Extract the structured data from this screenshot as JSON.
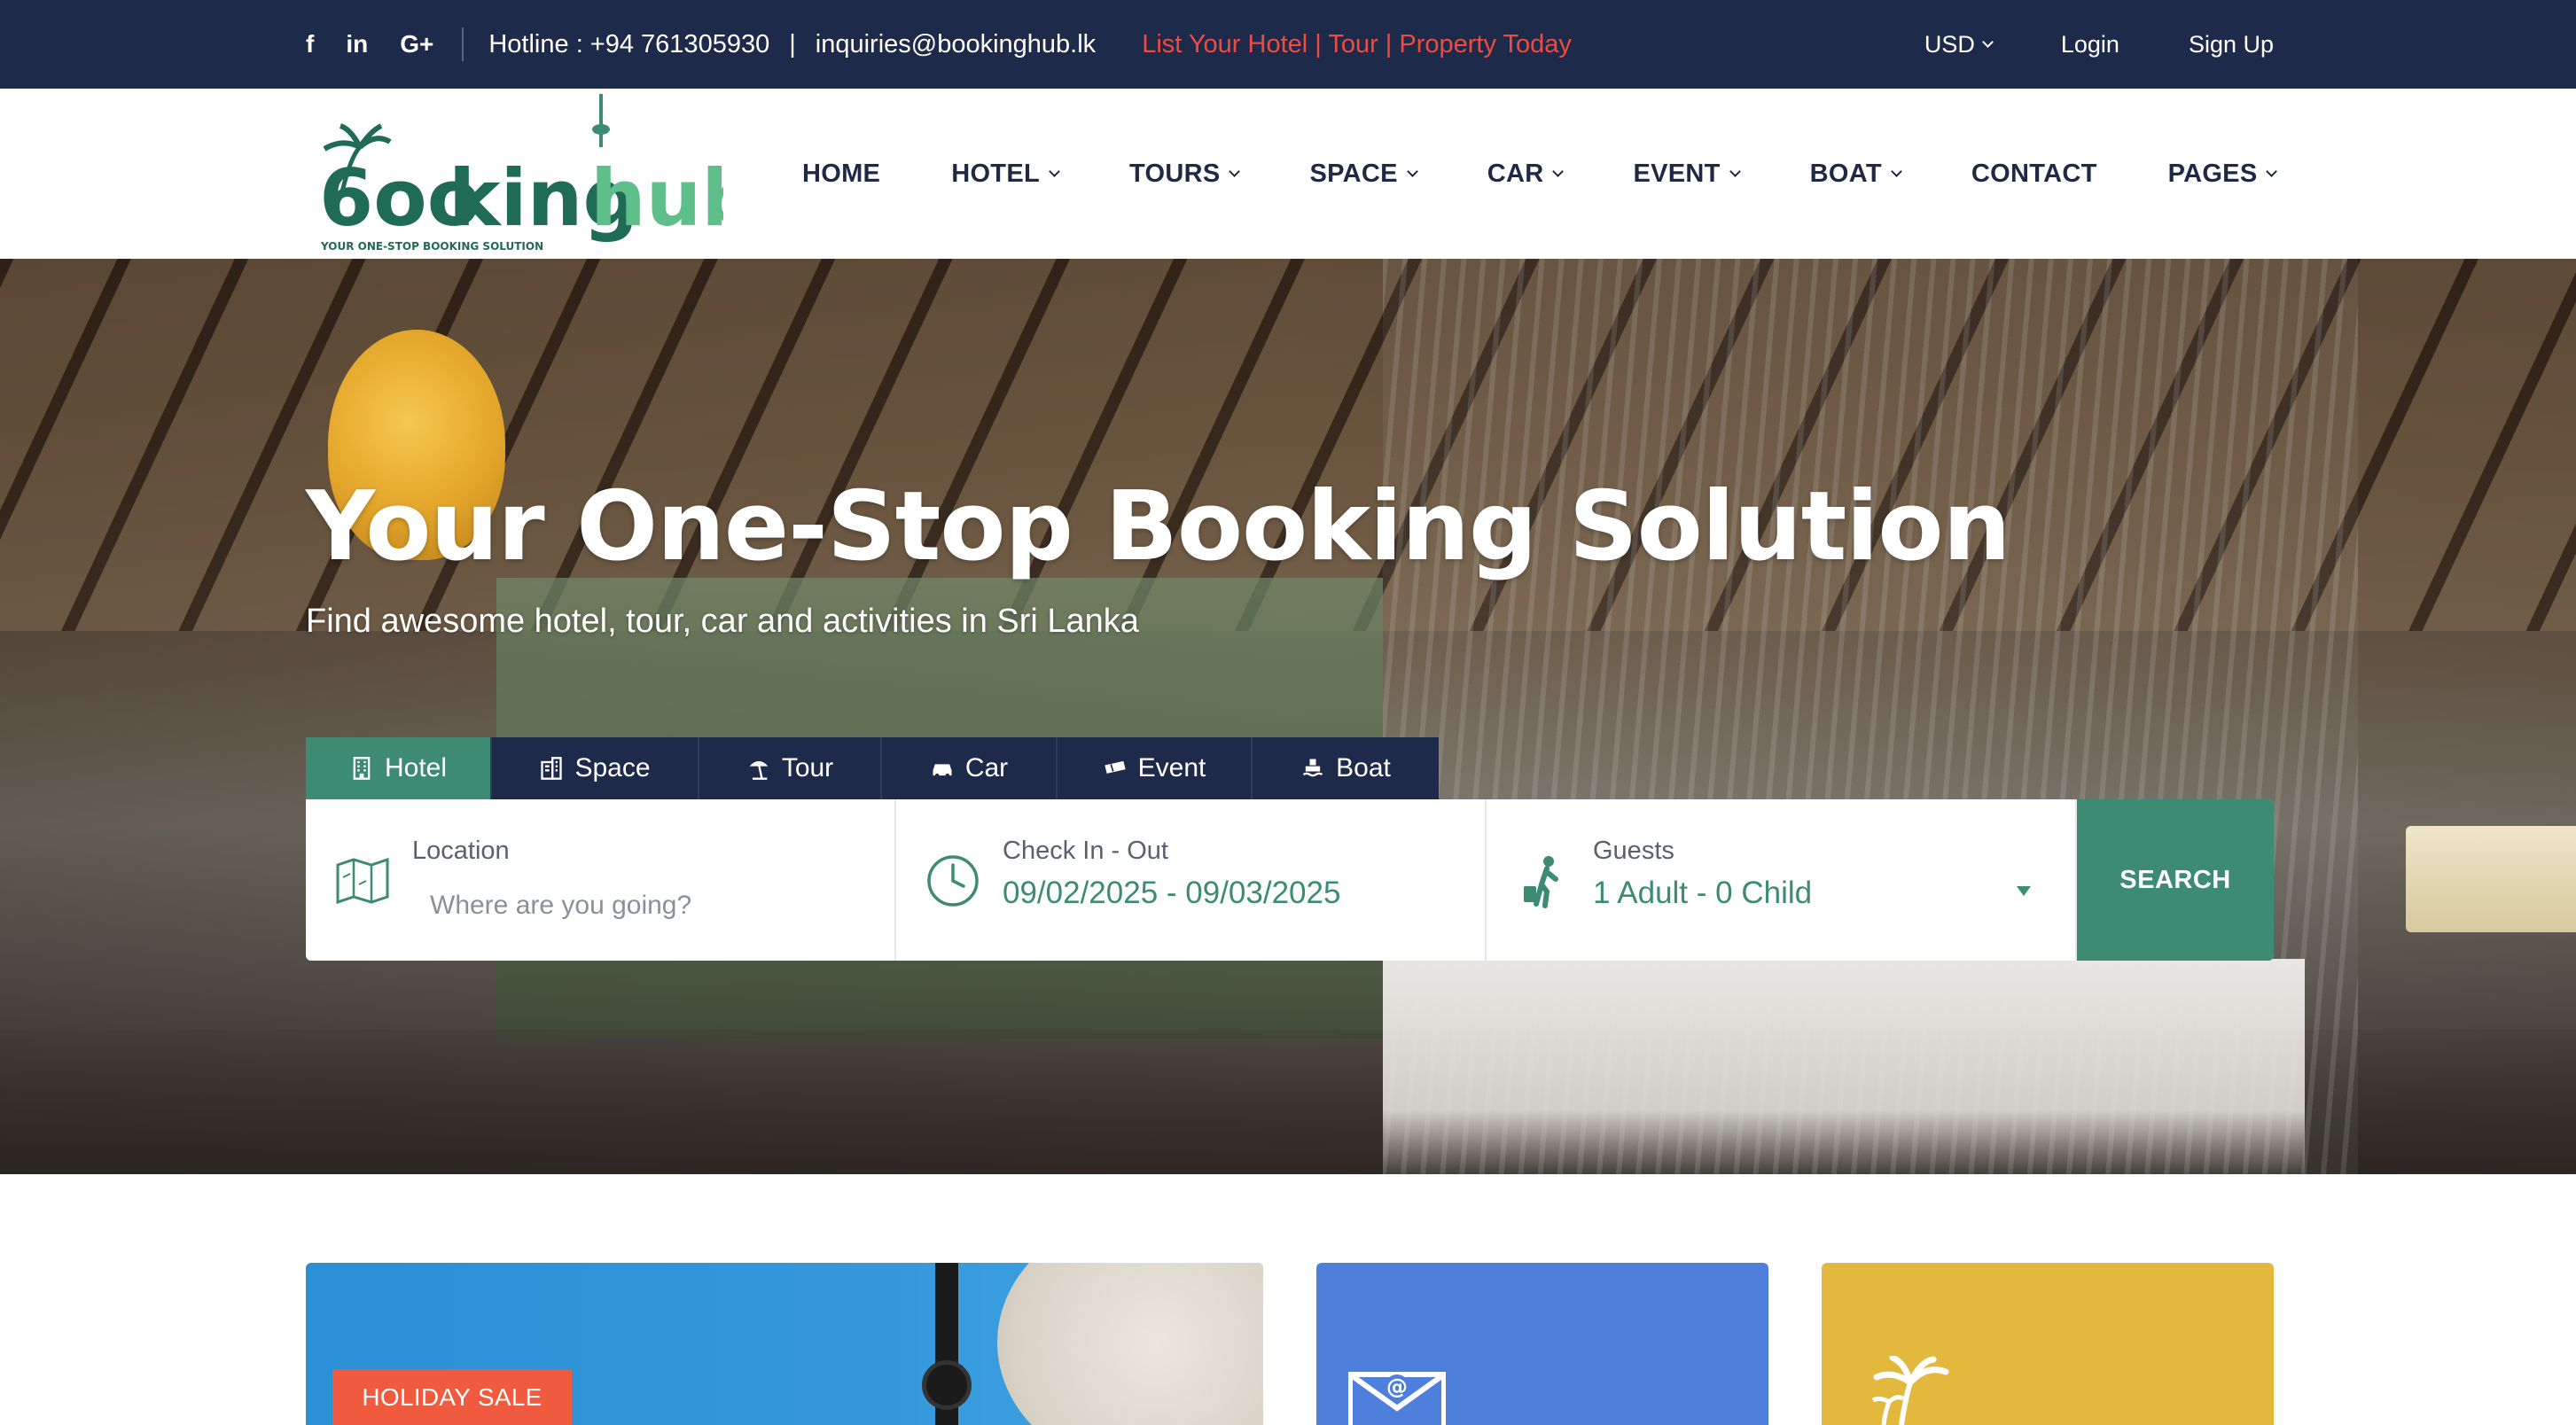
{
  "topbar": {
    "social": [
      {
        "icon": "facebook-icon",
        "glyph": "f"
      },
      {
        "icon": "linkedin-icon",
        "glyph": "in"
      },
      {
        "icon": "google-plus-icon",
        "glyph": "G+"
      }
    ],
    "hotline": "Hotline : +94 761305930",
    "divider": "|",
    "email": "inquiries@bookinghub.lk",
    "promo": "List Your Hotel | Tour | Property Today",
    "currency": "USD",
    "login": "Login",
    "signup": "Sign Up"
  },
  "logo": {
    "text": "Bookinghub",
    "tagline": "YOUR ONE-STOP BOOKING SOLUTION"
  },
  "nav": [
    {
      "label": "HOME",
      "dropdown": false
    },
    {
      "label": "HOTEL",
      "dropdown": true
    },
    {
      "label": "TOURS",
      "dropdown": true
    },
    {
      "label": "SPACE",
      "dropdown": true
    },
    {
      "label": "CAR",
      "dropdown": true
    },
    {
      "label": "EVENT",
      "dropdown": true
    },
    {
      "label": "BOAT",
      "dropdown": true
    },
    {
      "label": "CONTACT",
      "dropdown": false
    },
    {
      "label": "PAGES",
      "dropdown": true
    }
  ],
  "hero": {
    "title": "Your One-Stop Booking Solution",
    "subtitle": "Find awesome hotel, tour, car and activities in Sri Lanka"
  },
  "tabs": [
    {
      "label": "Hotel",
      "icon": "building-icon",
      "active": true
    },
    {
      "label": "Space",
      "icon": "office-icon",
      "active": false
    },
    {
      "label": "Tour",
      "icon": "beach-umbrella-icon",
      "active": false
    },
    {
      "label": "Car",
      "icon": "car-icon",
      "active": false
    },
    {
      "label": "Event",
      "icon": "ticket-icon",
      "active": false
    },
    {
      "label": "Boat",
      "icon": "ship-icon",
      "active": false
    }
  ],
  "search": {
    "location_label": "Location",
    "location_placeholder": "Where are you going?",
    "dates_label": "Check In - Out",
    "dates_value": "09/02/2025 - 09/03/2025",
    "guests_label": "Guests",
    "guests_value": "1 Adult - 0 Child",
    "button": "SEARCH"
  },
  "cards": [
    {
      "badge": "HOLIDAY SALE"
    },
    {
      "icon": "email-envelope-icon"
    },
    {
      "icon": "palm-tree-icon"
    }
  ],
  "colors": {
    "navy": "#1e2a4a",
    "brand_green": "#3e8b74",
    "promo_red": "#f04b3e",
    "badge_orange": "#f05a3e",
    "card_blue": "#4f7fdc",
    "card_yellow": "#e2b93d"
  }
}
